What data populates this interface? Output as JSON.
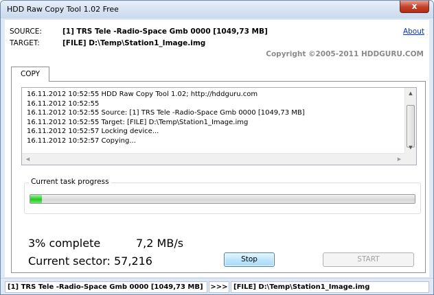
{
  "window": {
    "title": "HDD Raw Copy Tool 1.02   Free",
    "close_glyph": "x"
  },
  "header": {
    "source_label": "SOURCE:",
    "source_value": "[1]  TRS Tele -Radio-Space Gmb   0000   [1049,73 MB]",
    "target_label": "TARGET:",
    "target_value": "[FILE] D:\\Temp\\Station1_Image.img",
    "about_link": "About",
    "copyright": "Copyright ©2005-2011 HDDGURU.COM"
  },
  "tabs": [
    {
      "label": "COPY",
      "active": true
    }
  ],
  "log": [
    "16.11.2012 10:52:55   HDD Raw Copy Tool 1.02; http://hddguru.com",
    "16.11.2012 10:52:55",
    "16.11.2012 10:52:55   Source: [1]  TRS Tele -Radio-Space Gmb   0000   [1049,73 MB]",
    "16.11.2012 10:52:55   Target: [FILE] D:\\Temp\\Station1_Image.img",
    "16.11.2012 10:52:57   Locking device...",
    "16.11.2012 10:52:57   Copying..."
  ],
  "progress": {
    "caption": "Current task progress",
    "fraction": 0.03,
    "color": "#22c922",
    "percent_text": "3% complete",
    "speed_text": "7,2 MB/s",
    "sector_text": "Current sector: 57,216"
  },
  "buttons": {
    "stop": "Stop",
    "start": "START"
  },
  "statusbar": {
    "source": "[1]  TRS Tele -Radio-Space Gmb   0000   [1049,73 MB]",
    "arrow": ">>>",
    "target": "[FILE] D:\\Temp\\Station1_Image.img"
  },
  "icons": [
    "close-icon",
    "scroll-up-icon",
    "scroll-down-icon",
    "scroll-left-icon",
    "scroll-right-icon"
  ]
}
